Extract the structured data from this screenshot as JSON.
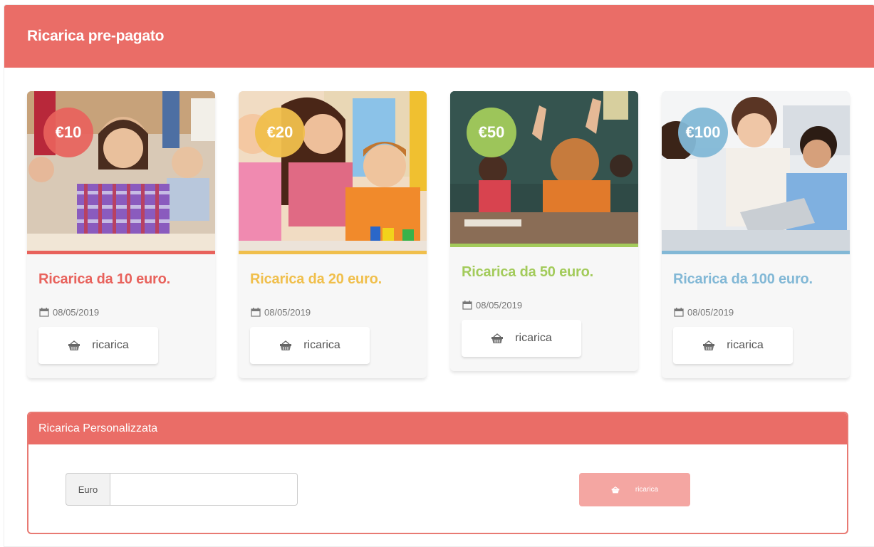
{
  "panel": {
    "title": "Ricarica pre-pagato"
  },
  "cards": [
    {
      "badge": "€10",
      "title": "Ricarica da 10 euro.",
      "date": "08/05/2019",
      "button": "ricarica",
      "color": "#e8625c"
    },
    {
      "badge": "€20",
      "title": "Ricarica da 20 euro.",
      "date": "08/05/2019",
      "button": "ricarica",
      "color": "#f0bf4c"
    },
    {
      "badge": "€50",
      "title": "Ricarica da 50 euro.",
      "date": "08/05/2019",
      "button": "ricarica",
      "color": "#a3cb5b"
    },
    {
      "badge": "€100",
      "title": "Ricarica da 100 euro.",
      "date": "08/05/2019",
      "button": "ricarica",
      "color": "#82b8d6"
    }
  ],
  "custom": {
    "title": "Ricarica Personalizzata",
    "addon": "Euro",
    "input_value": "",
    "input_placeholder": "",
    "button": "ricarica"
  },
  "icons": {
    "date": "calendar-icon",
    "button": "basket-icon"
  }
}
